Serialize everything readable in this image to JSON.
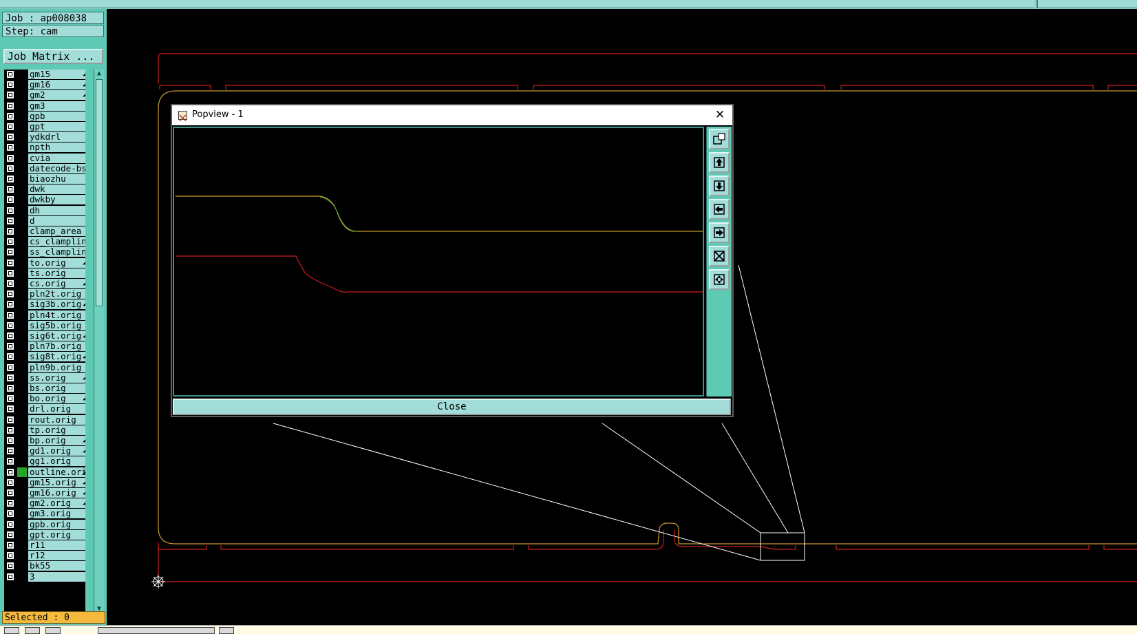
{
  "job": {
    "job_label": "Job : ap008038",
    "step_label": "Step: cam"
  },
  "job_matrix_button": "Job Matrix ...",
  "layers": [
    {
      "name": "gm15",
      "arrow": true
    },
    {
      "name": "gm16",
      "arrow": true
    },
    {
      "name": "gm2",
      "arrow": true
    },
    {
      "name": "gm3",
      "arrow": false
    },
    {
      "name": "gpb",
      "arrow": false
    },
    {
      "name": "gpt",
      "arrow": false
    },
    {
      "name": "ydkdrl",
      "arrow": false
    },
    {
      "name": "npth",
      "arrow": false
    },
    {
      "name": "cvia",
      "arrow": false
    },
    {
      "name": "datecode-bs",
      "arrow": false
    },
    {
      "name": "biaozhu",
      "arrow": false
    },
    {
      "name": "dwk",
      "arrow": false
    },
    {
      "name": "dwkby",
      "arrow": false
    },
    {
      "name": "dh",
      "arrow": false
    },
    {
      "name": "d",
      "arrow": false
    },
    {
      "name": "clamp_area",
      "arrow": false
    },
    {
      "name": "cs_clampline",
      "arrow": false
    },
    {
      "name": "ss_clampline",
      "arrow": false
    },
    {
      "name": "to.orig",
      "arrow": true
    },
    {
      "name": "ts.orig",
      "arrow": false
    },
    {
      "name": "cs.orig",
      "arrow": true
    },
    {
      "name": "pln2t.orig",
      "arrow": false
    },
    {
      "name": "sig3b.orig",
      "arrow": true
    },
    {
      "name": "pln4t.orig",
      "arrow": false
    },
    {
      "name": "sig5b.orig",
      "arrow": false
    },
    {
      "name": "sig6t.orig",
      "arrow": true
    },
    {
      "name": "pln7b.orig",
      "arrow": false
    },
    {
      "name": "sig8t.orig",
      "arrow": true
    },
    {
      "name": "pln9b.orig",
      "arrow": false
    },
    {
      "name": "ss.orig",
      "arrow": true
    },
    {
      "name": "bs.orig",
      "arrow": false
    },
    {
      "name": "bo.orig",
      "arrow": true
    },
    {
      "name": "drl.orig",
      "arrow": false
    },
    {
      "name": "rout.orig",
      "arrow": false
    },
    {
      "name": "tp.orig",
      "arrow": false
    },
    {
      "name": "bp.orig",
      "arrow": true
    },
    {
      "name": "gd1.orig",
      "arrow": true
    },
    {
      "name": "gg1.orig",
      "arrow": false
    },
    {
      "name": "outline.orig",
      "arrow": true,
      "active": true
    },
    {
      "name": "gm15.orig",
      "arrow": true
    },
    {
      "name": "gm16.orig",
      "arrow": true
    },
    {
      "name": "gm2.orig",
      "arrow": true
    },
    {
      "name": "gm3.orig",
      "arrow": false
    },
    {
      "name": "gpb.orig",
      "arrow": false
    },
    {
      "name": "gpt.orig",
      "arrow": false
    },
    {
      "name": "r11",
      "arrow": false
    },
    {
      "name": "r12",
      "arrow": false
    },
    {
      "name": "bk55",
      "arrow": false
    },
    {
      "name": "3",
      "arrow": false
    }
  ],
  "selected_label": "Selected : 0",
  "popview": {
    "title": "Popview - 1",
    "close_glyph": "✕",
    "close_button": "Close"
  },
  "icons": {
    "up_arrow": "▲",
    "down_arrow": "▼",
    "layer_arrow": "◢"
  },
  "colors": {
    "outline_red": "#cc1f1f",
    "outline_orange": "#c79a2c",
    "panel_teal": "#5fcab4",
    "selected_orange": "#f4b93d"
  }
}
